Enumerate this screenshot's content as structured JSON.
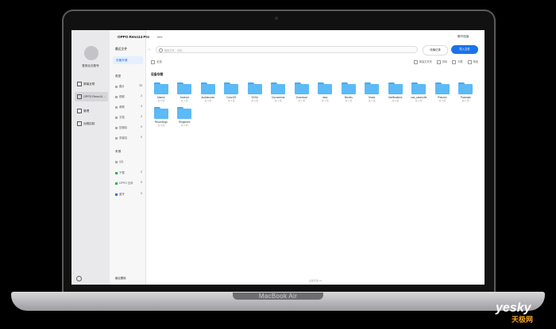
{
  "window": {
    "title": "OPPO Reno14 Pro",
    "battery": "64%",
    "connect_label": "断开连接"
  },
  "device_panel": {
    "user": "登录后无账号",
    "items": [
      {
        "label": "屏幕互联",
        "active": false
      },
      {
        "label": "OPPO Reno14 ...",
        "active": true
      },
      {
        "label": "管理",
        "active": false
      },
      {
        "label": "远程控制",
        "active": false
      }
    ]
  },
  "nav": {
    "header": "最近文件",
    "storage": "设备存储",
    "type_section": "类型",
    "types": [
      {
        "label": "图片",
        "count": "33"
      },
      {
        "label": "视频",
        "count": "2"
      },
      {
        "label": "音频",
        "count": "3"
      },
      {
        "label": "文档",
        "count": "2"
      },
      {
        "label": "压缩包",
        "count": "0"
      },
      {
        "label": "安装包",
        "count": "0"
      }
    ],
    "source_section": "来源",
    "sources": [
      {
        "label": "QQ",
        "count": ""
      },
      {
        "label": "下载",
        "count": "2"
      },
      {
        "label": "OPPO 互传",
        "count": "0"
      },
      {
        "label": "蓝牙",
        "count": "0"
      }
    ],
    "bottom": "最近删除"
  },
  "toolbar": {
    "search_placeholder": "搜索文件、手机...",
    "record_label": "传输记录",
    "import_label": "导入文件",
    "select_all": "全选",
    "tools": [
      "新建文件夹",
      "排序",
      "列表",
      "筛选"
    ]
  },
  "section_title": "设备存储",
  "folders": [
    {
      "name": "Alarms",
      "count": "共 0 项"
    },
    {
      "name": "Android",
      "count": "共 1 项"
    },
    {
      "name": "Audiobooks",
      "count": "共 0 项"
    },
    {
      "name": "ColorOS",
      "count": "共 4 项"
    },
    {
      "name": "DCIM",
      "count": "共 2 项"
    },
    {
      "name": "Documents",
      "count": "共 3 项"
    },
    {
      "name": "Download",
      "count": "共 1 项"
    },
    {
      "name": "misc",
      "count": "共 1 项"
    },
    {
      "name": "Movies",
      "count": "共 1 项"
    },
    {
      "name": "Music",
      "count": "共 1 项"
    },
    {
      "name": "Notifications",
      "count": "共 0 项"
    },
    {
      "name": "oca_cases-file",
      "count": "共 1 项"
    },
    {
      "name": "Pictures",
      "count": "共 2 项"
    },
    {
      "name": "Podcasts",
      "count": "共 0 项"
    },
    {
      "name": "Recordings",
      "count": "共 0 项"
    },
    {
      "name": "Ringtones",
      "count": "共 0 项"
    }
  ],
  "footer": "设备存储 16",
  "laptop_label": "MacBook Air",
  "watermark": {
    "brand": "yesky",
    "sub": "天极网"
  },
  "colors": {
    "accent": "#1a73e8",
    "folder": "#5cbaf7"
  }
}
